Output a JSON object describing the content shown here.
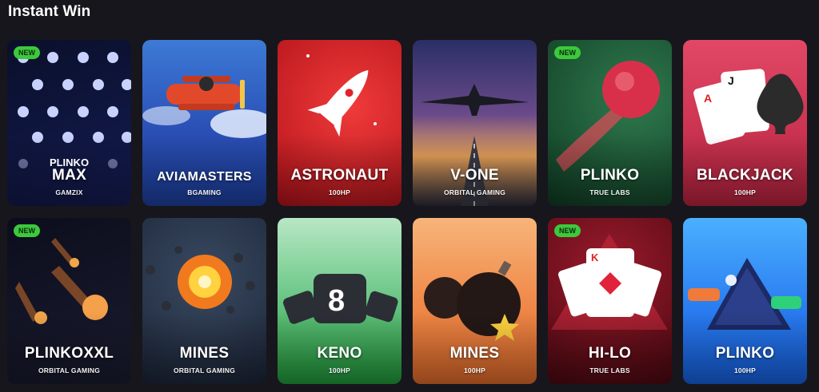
{
  "section_title": "Instant Win",
  "games": [
    {
      "pre": "PLINKO",
      "name": "MAX",
      "provider": "GAMZIX",
      "badge": "NEW",
      "bg": [
        "#0a0f2a",
        "#141c52"
      ]
    },
    {
      "pre": "",
      "name": "AVIAMASTERS",
      "provider": "BGAMING",
      "badge": "",
      "bg": [
        "#1d3f9e",
        "#2a4fb5"
      ]
    },
    {
      "pre": "",
      "name": "ASTRONAUT",
      "provider": "100HP",
      "badge": "",
      "bg": [
        "#e0232c",
        "#b0121a"
      ]
    },
    {
      "pre": "",
      "name": "V-ONE",
      "provider": "ORBITAL GAMING",
      "badge": "",
      "bg": [
        "#3a3f7a",
        "#e8a25a"
      ]
    },
    {
      "pre": "",
      "name": "PLINKO",
      "provider": "TRUE LABS",
      "badge": "NEW",
      "bg": [
        "#1f5a3a",
        "#0f3a22"
      ]
    },
    {
      "pre": "",
      "name": "BLACKJACK",
      "provider": "100HP",
      "badge": "",
      "bg": [
        "#e24866",
        "#b8233f"
      ]
    },
    {
      "pre": "",
      "name": "PLINKOXXL",
      "provider": "ORBITAL GAMING",
      "badge": "NEW",
      "bg": [
        "#0c0d1c",
        "#1a1c30"
      ]
    },
    {
      "pre": "",
      "name": "MINES",
      "provider": "ORBITAL GAMING",
      "badge": "",
      "bg": [
        "#243448",
        "#1a2436"
      ]
    },
    {
      "pre": "",
      "name": "KENO",
      "provider": "100HP",
      "badge": "",
      "bg": [
        "#b8e7c4",
        "#1f9a3a"
      ]
    },
    {
      "pre": "",
      "name": "MINES",
      "provider": "100HP",
      "badge": "",
      "bg": [
        "#f5a56a",
        "#e06a2a"
      ]
    },
    {
      "pre": "",
      "name": "HI-LO",
      "provider": "TRUE LABS",
      "badge": "NEW",
      "bg": [
        "#7a0f1e",
        "#4a0810"
      ]
    },
    {
      "pre": "",
      "name": "PLINKO",
      "provider": "100HP",
      "badge": "",
      "bg": [
        "#3aa0ff",
        "#1660e0"
      ]
    }
  ]
}
